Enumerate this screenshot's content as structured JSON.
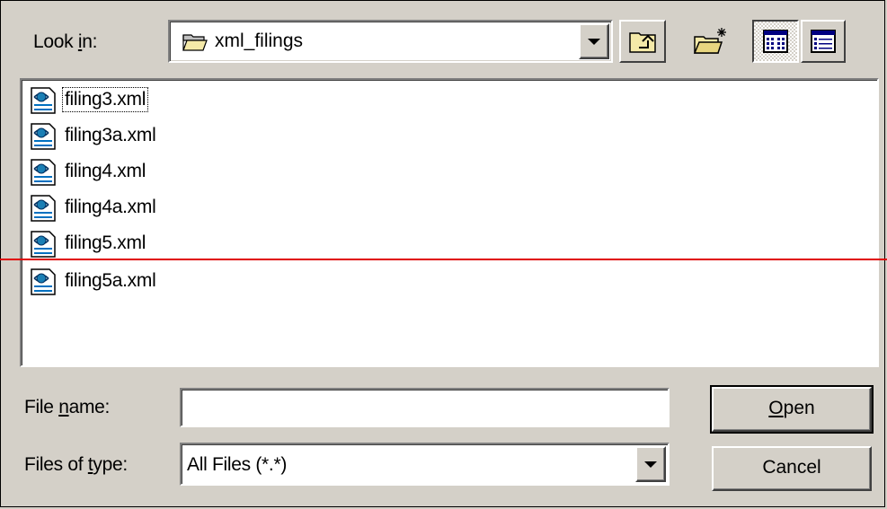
{
  "look_in": {
    "label_pre": "Look ",
    "label_key": "i",
    "label_post": "n:",
    "value": "xml_filings",
    "folder_icon": "open-folder-icon"
  },
  "toolbar": {
    "up_folder_icon": "up-one-level-icon",
    "new_folder_icon": "create-new-folder-icon",
    "list_view_icon": "list-view-icon",
    "details_view_icon": "details-view-icon"
  },
  "files": [
    {
      "name": "filing3.xml",
      "icon": "xml-file-icon",
      "focused": true
    },
    {
      "name": "filing3a.xml",
      "icon": "xml-file-icon",
      "focused": false
    },
    {
      "name": "filing4.xml",
      "icon": "xml-file-icon",
      "focused": false
    },
    {
      "name": "filing4a.xml",
      "icon": "xml-file-icon",
      "focused": false
    },
    {
      "name": "filing5.xml",
      "icon": "xml-file-icon",
      "focused": false
    },
    {
      "name": "filing5a.xml",
      "icon": "xml-file-icon",
      "focused": false
    }
  ],
  "file_name": {
    "label_pre": "File ",
    "label_key": "n",
    "label_post": "ame:",
    "value": ""
  },
  "file_type": {
    "label_pre": "Files of ",
    "label_key": "t",
    "label_post": "ype:",
    "value": "All Files (*.*)"
  },
  "buttons": {
    "open_key": "O",
    "open_rest": "pen",
    "cancel": "Cancel"
  },
  "colors": {
    "face": "#d4d0c8",
    "annotation_line": "#e00000"
  }
}
